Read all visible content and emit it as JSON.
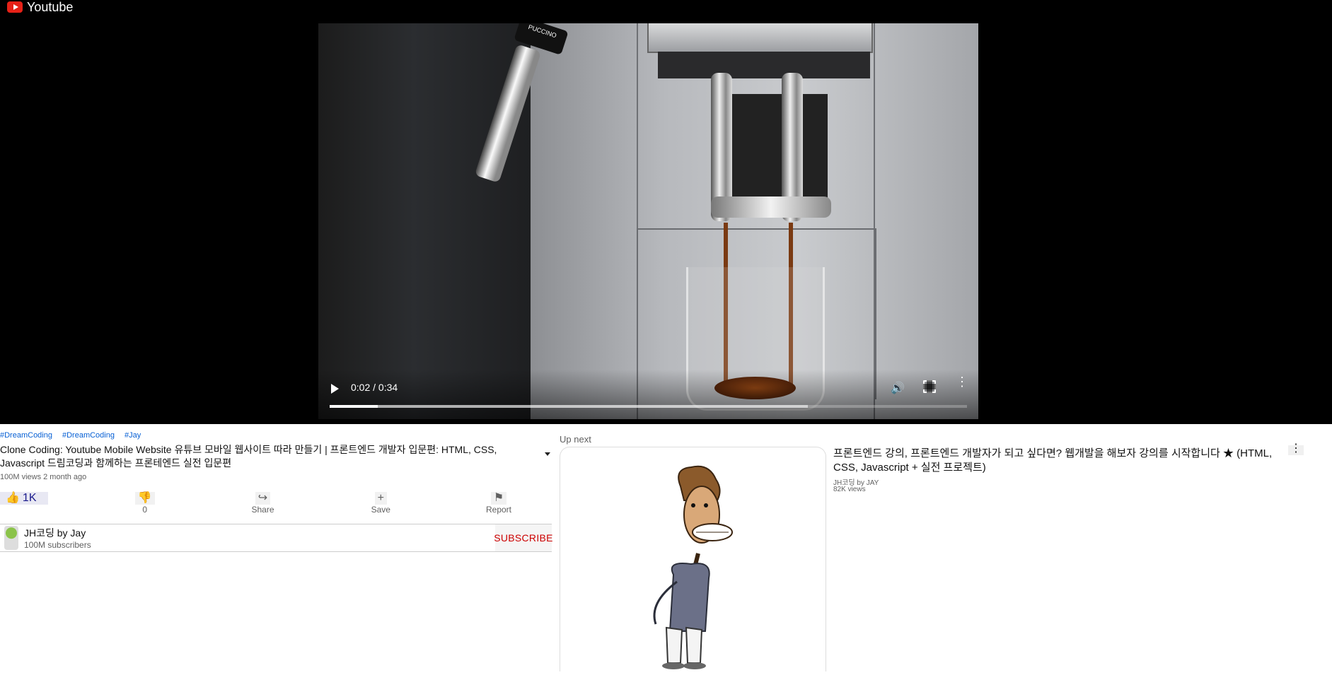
{
  "app": {
    "title": "Youtube",
    "brand_color": "#e62117"
  },
  "player": {
    "time": "0:02 / 0:34",
    "played_fraction": 0.075,
    "buffered_fraction": 0.75,
    "steam_wand_text": "PUCCINO"
  },
  "video": {
    "hashtags": [
      "#DreamCoding",
      "#DreamCoding",
      "#Jay"
    ],
    "title": "Clone Coding: Youtube Mobile Website 유튜브 모바일 웹사이트 따라 만들기 | 프론트엔드 개발자 입문편: HTML, CSS, Javascript 드림코딩과 함께하는 프론테엔드 실전 입문편",
    "meta": "100M views 2 month ago",
    "actions": {
      "like": "1K",
      "dislike": "0",
      "share": "Share",
      "save": "Save",
      "report": "Report"
    }
  },
  "channel": {
    "name": "JH코딩 by Jay",
    "subscribers": "100M subscribers",
    "subscribe_label": "SUBSCRIBE"
  },
  "upnext": {
    "label": "Up next",
    "items": [
      {
        "title": "프론트엔드 강의, 프론트엔드 개발자가 되고 싶다면? 웹개발을 해보자 강의를 시작합니다 ★ (HTML, CSS, Javascript + 실전 프로젝트)",
        "channel": "JH코딩 by JAY",
        "views": "82K views"
      }
    ]
  }
}
